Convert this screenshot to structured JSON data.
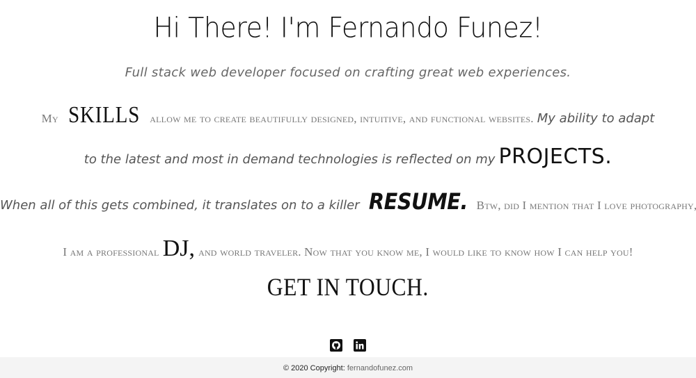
{
  "hero": {
    "title": "Hi There! I'm Fernando Funez!",
    "subtitle": "Full stack web developer focused on crafting great web experiences."
  },
  "bio": {
    "line1": {
      "pre": "My",
      "skills_link": "SKILLS",
      "mid": "allow me to create beautifully designed, intuitive, and functional websites.",
      "post": "My ability to adapt"
    },
    "line2": {
      "pre": "to the latest and most in demand technologies is reflected on my",
      "projects_link": "PROJECTS."
    },
    "line3": {
      "pre": "When all of this gets combined, it translates on to a killer",
      "resume_link": "RESUME.",
      "post": "Btw, did I mention that I love photography,"
    },
    "line4": {
      "pre": "I am a professional",
      "dj_link": "DJ,",
      "post": "and world traveler. Now that you know me, I would like to know how I can help you!"
    }
  },
  "cta": {
    "label": "GET IN TOUCH."
  },
  "social": {
    "icons": [
      "github-icon",
      "linkedin-icon"
    ]
  },
  "footer": {
    "copyright": "© 2020 Copyright:",
    "site_link": "fernandofunez.com"
  },
  "colors": {
    "text_dark": "#111111",
    "text_muted": "#666666",
    "footer_bg": "#f4f4f4"
  }
}
